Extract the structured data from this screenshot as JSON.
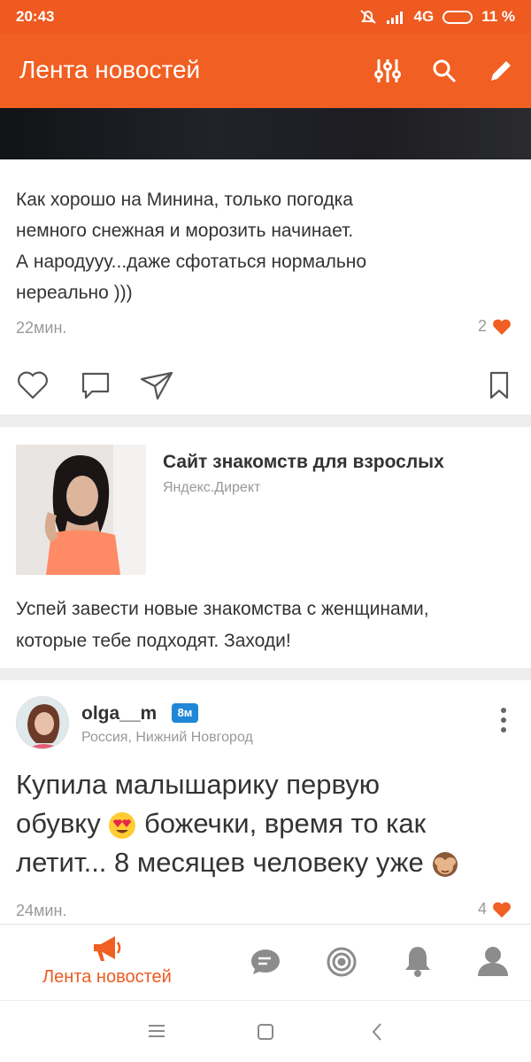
{
  "status_bar": {
    "time": "20:43",
    "network": "4G",
    "battery": "11 %"
  },
  "app_bar": {
    "title": "Лента новостей",
    "icons": [
      "filter-icon",
      "search-icon",
      "pencil-icon"
    ]
  },
  "post1": {
    "text_lines": [
      "Как хорошо на Минина, только погодка",
      "немного снежная и морозить начинает.",
      "А народууу...даже сфотаться нормально",
      "нереально )))"
    ],
    "time": "22мин.",
    "likes": "2"
  },
  "ad": {
    "title": "Сайт знакомств для взрослых",
    "source": "Яндекс.Директ",
    "body_lines": [
      "Успей завести новые знакомства с женщинами,",
      "которые тебе подходят. Заходи!"
    ]
  },
  "post2": {
    "author": "olga__m",
    "badge": "8м",
    "location": "Россия, Нижний Новгород",
    "text_line1": "Купила малышарику первую",
    "text_line2a": "обувку",
    "text_line2b": "божечки, время то как",
    "text_line3": "летит... 8 месяцев человеку уже",
    "time": "24мин.",
    "likes": "4"
  },
  "bottom_nav": {
    "active_label": "Лента новостей"
  },
  "colors": {
    "accent": "#f15f22",
    "badge": "#1f87d6"
  }
}
